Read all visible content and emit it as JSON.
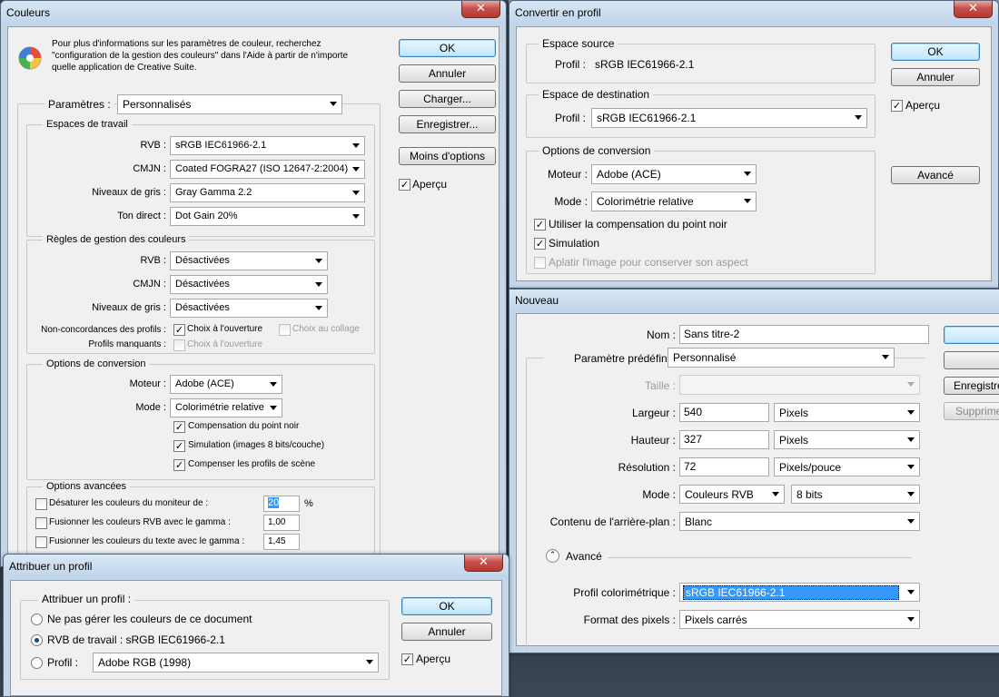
{
  "couleurs": {
    "title": "Couleurs",
    "info": "Pour plus d'informations sur les paramètres de couleur, recherchez \"configuration de la gestion des couleurs\" dans l'Aide à partir de n'importe quelle application de Creative Suite.",
    "buttons": {
      "ok": "OK",
      "annuler": "Annuler",
      "charger": "Charger...",
      "enregistrer": "Enregistrer...",
      "moins": "Moins d'options"
    },
    "apercu": "Aperçu",
    "parametres_label": "Paramètres :",
    "parametres_value": "Personnalisés",
    "espaces": {
      "title": "Espaces de travail",
      "rvb_label": "RVB :",
      "rvb_value": "sRGB IEC61966-2.1",
      "cmjn_label": "CMJN :",
      "cmjn_value": "Coated FOGRA27 (ISO 12647-2:2004)",
      "gris_label": "Niveaux de gris :",
      "gris_value": "Gray Gamma 2.2",
      "direct_label": "Ton direct :",
      "direct_value": "Dot Gain 20%"
    },
    "regles": {
      "title": "Règles de gestion des couleurs",
      "rvb_label": "RVB :",
      "rvb_value": "Désactivées",
      "cmjn_label": "CMJN :",
      "cmjn_value": "Désactivées",
      "gris_label": "Niveaux de gris :",
      "gris_value": "Désactivées",
      "nonconc_label": "Non-concordances des profils :",
      "choix_ouverture": "Choix à l'ouverture",
      "choix_collage": "Choix au collage",
      "manquants_label": "Profils manquants :",
      "manquants_choix": "Choix à l'ouverture"
    },
    "conversion": {
      "title": "Options de conversion",
      "moteur_label": "Moteur :",
      "moteur_value": "Adobe (ACE)",
      "mode_label": "Mode :",
      "mode_value": "Colorimétrie relative",
      "compensation": "Compensation du point noir",
      "simulation": "Simulation (images 8 bits/couche)",
      "compenser": "Compenser les profils de scène"
    },
    "avancees": {
      "title": "Options avancées",
      "desaturer": "Désaturer les couleurs du moniteur de :",
      "desaturer_value": "20",
      "desaturer_unit": "%",
      "fusion_rvb": "Fusionner les couleurs RVB avec le gamma :",
      "fusion_rvb_value": "1,00",
      "fusion_texte": "Fusionner les couleurs du texte avec le gamma :",
      "fusion_texte_value": "1,45"
    }
  },
  "convertir": {
    "title": "Convertir en profil",
    "source_title": "Espace source",
    "source_label": "Profil :",
    "source_value": "sRGB IEC61966-2.1",
    "dest_title": "Espace de destination",
    "dest_label": "Profil :",
    "dest_value": "sRGB IEC61966-2.1",
    "options_title": "Options de conversion",
    "moteur_label": "Moteur :",
    "moteur_value": "Adobe (ACE)",
    "mode_label": "Mode :",
    "mode_value": "Colorimétrie relative",
    "compensation": "Utiliser la compensation du point noir",
    "simulation": "Simulation",
    "aplatir": "Aplatir l'image pour conserver son aspect",
    "buttons": {
      "ok": "OK",
      "annuler": "Annuler",
      "avance": "Avancé"
    },
    "apercu": "Aperçu"
  },
  "nouveau": {
    "title": "Nouveau",
    "nom_label": "Nom :",
    "nom_value": "Sans titre-2",
    "preset_label": "Paramètre prédéfini :",
    "preset_value": "Personnalisé",
    "taille_label": "Taille :",
    "largeur_label": "Largeur :",
    "largeur_value": "540",
    "largeur_unit": "Pixels",
    "hauteur_label": "Hauteur :",
    "hauteur_value": "327",
    "hauteur_unit": "Pixels",
    "resolution_label": "Résolution :",
    "resolution_value": "72",
    "resolution_unit": "Pixels/pouce",
    "mode_label": "Mode :",
    "mode_value": "Couleurs RVB",
    "mode_bits": "8 bits",
    "fond_label": "Contenu de l'arrière-plan :",
    "fond_value": "Blanc",
    "avance_label": "Avancé",
    "profil_label": "Profil colorimétrique :",
    "profil_value": "sRGB IEC61966-2.1",
    "format_label": "Format des pixels :",
    "format_value": "Pixels carrés",
    "buttons": {
      "enregistrer": "Enregistre",
      "supprimer": "Supprime"
    }
  },
  "attribuer": {
    "title": "Attribuer un profil",
    "group_title": "Attribuer un profil :",
    "ne_pas_gerer": "Ne pas gérer les couleurs de ce document",
    "rvb_travail": "RVB de travail :  sRGB IEC61966-2.1",
    "profil_label": "Profil :",
    "profil_value": "Adobe RGB (1998)",
    "buttons": {
      "ok": "OK",
      "annuler": "Annuler"
    },
    "apercu": "Aperçu"
  }
}
